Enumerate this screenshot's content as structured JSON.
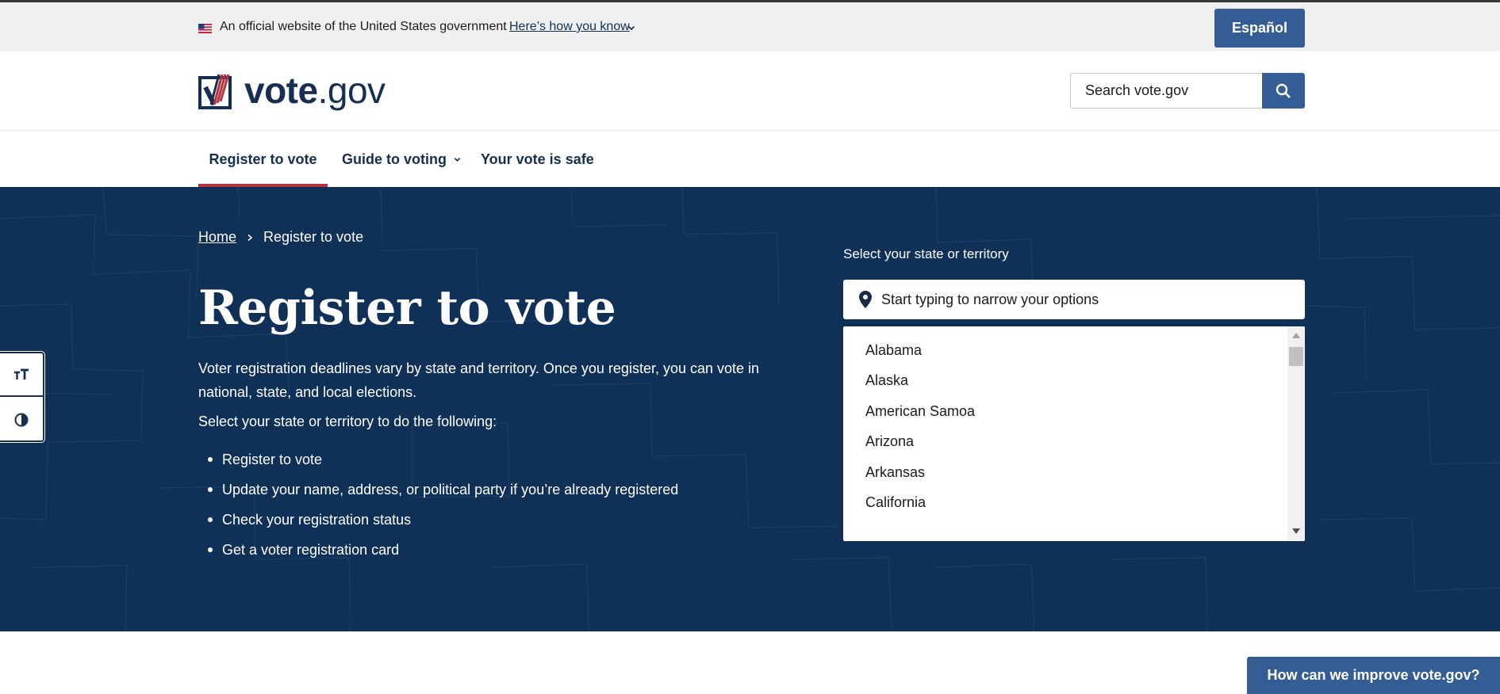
{
  "gov_banner": {
    "official_text": "An official website of the United States government",
    "how_you_know_link": "Here’s how you know",
    "language_button": "Español"
  },
  "header": {
    "logo": {
      "bold": "vote",
      "rest": ".gov"
    },
    "search": {
      "placeholder": "Search vote.gov",
      "button_icon": "search-icon"
    }
  },
  "nav": {
    "items": [
      {
        "label": "Register to vote",
        "active": true
      },
      {
        "label": "Guide to voting",
        "has_dropdown": true
      },
      {
        "label": "Your vote is safe"
      }
    ]
  },
  "hero": {
    "breadcrumb": {
      "home": "Home",
      "current": "Register to vote"
    },
    "title": "Register to vote",
    "intro": "Voter registration deadlines vary by state and territory. Once you register, you can vote in national, state, and local elections.",
    "select_prompt": "Select your state or territory to do the following:",
    "actions": [
      "Register to vote",
      "Update your name, address, or political party if you’re already registered",
      "Check your registration status",
      "Get a voter registration card"
    ]
  },
  "state_picker": {
    "label": "Select your state or territory",
    "placeholder": "Start typing to narrow your options",
    "options": [
      "Alabama",
      "Alaska",
      "American Samoa",
      "Arizona",
      "Arkansas",
      "California"
    ]
  },
  "side_tools": {
    "text_size_icon": "text-size-icon",
    "contrast_icon": "contrast-icon"
  },
  "feedback_button": "How can we improve vote.gov?",
  "colors": {
    "hero_bg": "#0f3158",
    "primary_button": "#345d96",
    "active_underline": "#b5333f",
    "nav_text": "#162e51"
  }
}
